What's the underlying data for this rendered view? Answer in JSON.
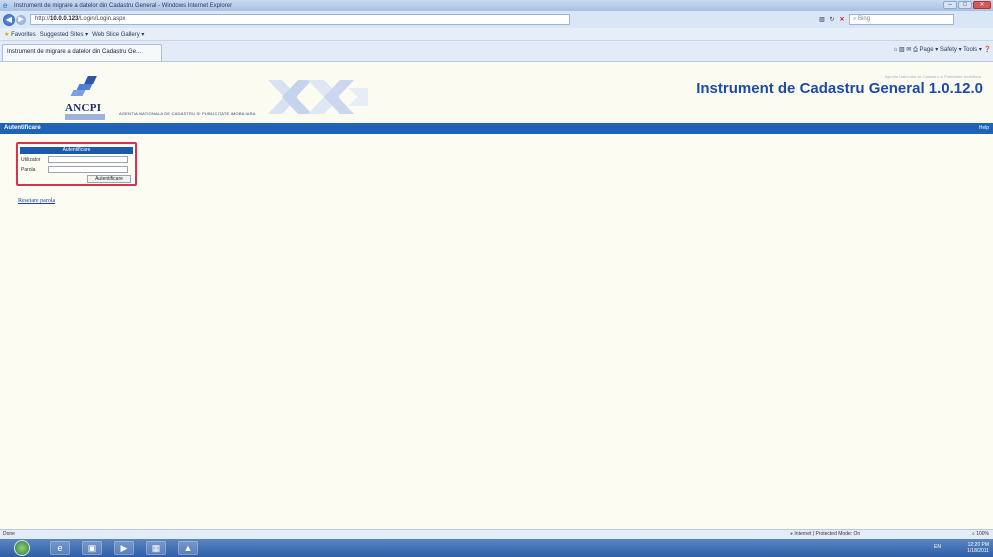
{
  "browser": {
    "window_title": "Instrument de migrare a datelor din Cadastru General - Windows Internet Explorer",
    "address_prefix": "http://",
    "address_host": "10.0.0.123",
    "address_path": "/Login/Login.aspx",
    "search_placeholder": "Bing",
    "favorites_label": "Favorites",
    "favorites_items": [
      "Suggested Sites ▾",
      "Web Slice Gallery ▾"
    ],
    "tab_title": "Instrument de migrare a datelor din Cadastru Ge...",
    "command_bar": "Page ▾   Safety ▾   Tools ▾"
  },
  "header": {
    "logo_acronym": "ANCPI",
    "logo_tagline": "",
    "agency_name": "AGENTIA NATIONALA DE CADASTRU SI PUBLICITATE IMOBILIARA",
    "app_title": "Instrument de Cadastru General 1.0.12.0",
    "app_title_small": "Agentia Nationala de Cadastru si Publicitate Imobiliara"
  },
  "navbar": {
    "left_label": "Autentificare",
    "help_label": "Help"
  },
  "login": {
    "heading": "Autentificare",
    "username_label": "Utilizator",
    "username_value": "",
    "password_label": "Parola",
    "password_value": "",
    "submit_label": "Autentificare"
  },
  "reset_link": "Resetare parola",
  "statusbar": {
    "left": "Done",
    "zone": "Internet | Protected Mode: On",
    "zoom": "100%"
  },
  "taskbar": {
    "language": "EN",
    "time": "12:20 PM",
    "date": "1/18/2011"
  },
  "colors": {
    "accent_blue": "#1e63b6",
    "title_blue": "#1e4aa8",
    "highlight_red": "#d8334f",
    "page_background": "#fcfcf2"
  }
}
